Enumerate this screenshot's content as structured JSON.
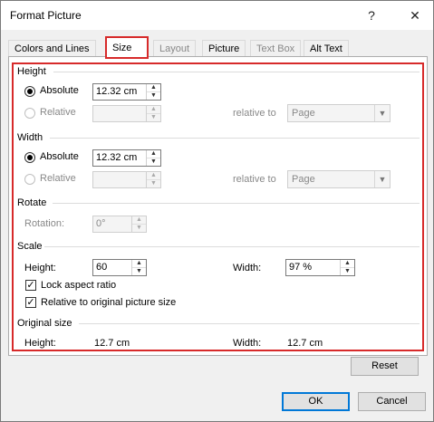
{
  "window": {
    "title": "Format Picture",
    "help": "?",
    "close": "✕"
  },
  "tabs": [
    {
      "label": "Colors and Lines"
    },
    {
      "label": "Size"
    },
    {
      "label": "Layout"
    },
    {
      "label": "Picture"
    },
    {
      "label": "Text Box"
    },
    {
      "label": "Alt Text"
    }
  ],
  "height": {
    "section": "Height",
    "absolute_label_pre": "Absolute",
    "absolute_value": "12.32 cm",
    "relative_label": "Relative",
    "relative_value": "",
    "relative_to_label": "relative to",
    "relative_to_value": "Page"
  },
  "width": {
    "section": "Width",
    "absolute_label": "Absolute",
    "absolute_value": "12.32 cm",
    "relative_label": "Relative",
    "relative_value": "",
    "relative_to_label": "relative to",
    "relative_to_value": "Page"
  },
  "rotate": {
    "section": "Rotate",
    "rotation_label": "Rotation:",
    "rotation_value": "0°"
  },
  "scale": {
    "section": "Scale",
    "height_label": "Height:",
    "height_value": "60",
    "width_label": "Width:",
    "width_value": "97 %",
    "lock_aspect_label": "Lock aspect ratio",
    "lock_aspect_checked": true,
    "relative_original_label": "Relative to original picture size",
    "relative_original_checked": true
  },
  "original": {
    "section": "Original size",
    "height_label": "Height:",
    "height_value": "12.7 cm",
    "width_label": "Width:",
    "width_value": "12.7 cm"
  },
  "buttons": {
    "reset": "Reset",
    "ok": "OK",
    "cancel": "Cancel"
  },
  "colors": {
    "highlight": "#d72a2a",
    "default_border": "#0078d7"
  }
}
